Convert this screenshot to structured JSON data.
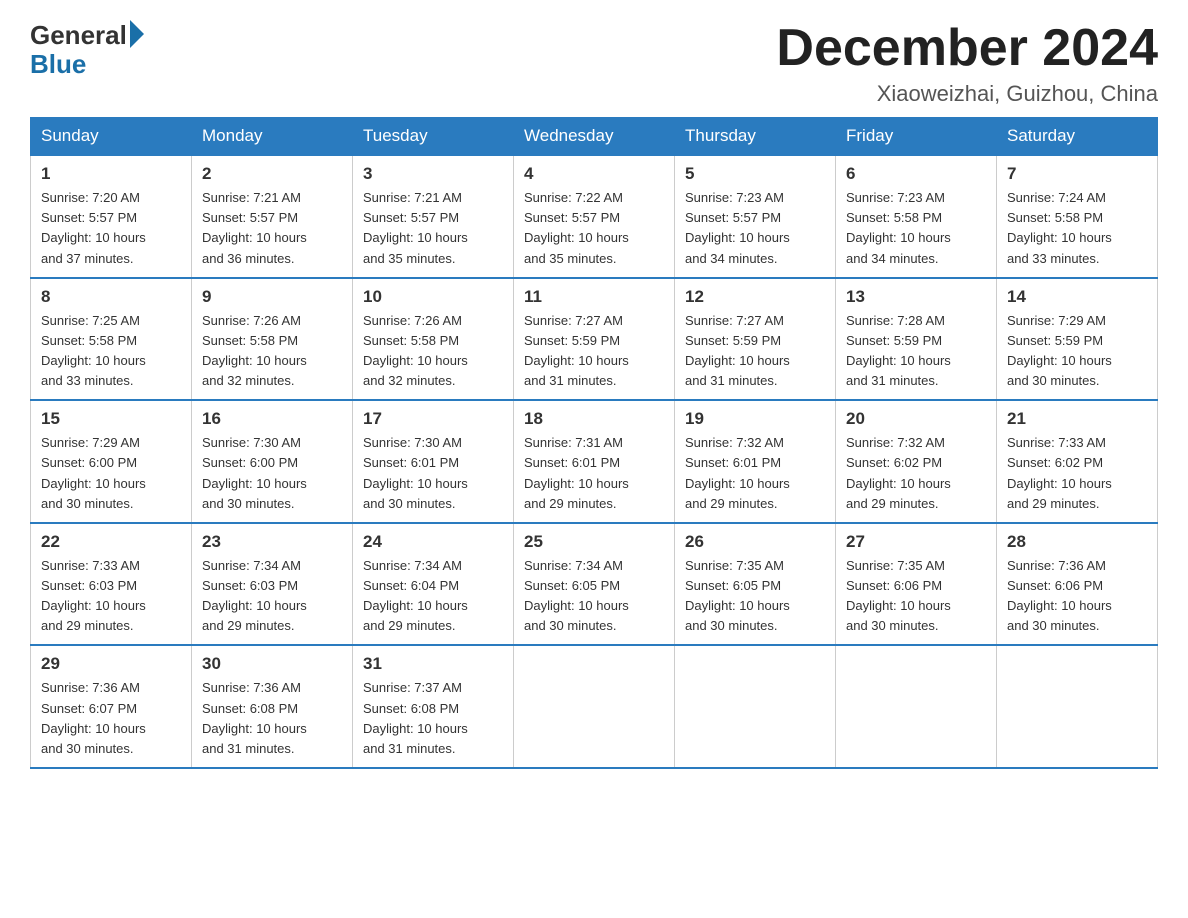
{
  "logo": {
    "general": "General",
    "blue": "Blue"
  },
  "title": "December 2024",
  "location": "Xiaoweizhai, Guizhou, China",
  "days_of_week": [
    "Sunday",
    "Monday",
    "Tuesday",
    "Wednesday",
    "Thursday",
    "Friday",
    "Saturday"
  ],
  "weeks": [
    [
      {
        "day": "1",
        "sunrise": "7:20 AM",
        "sunset": "5:57 PM",
        "daylight": "10 hours and 37 minutes."
      },
      {
        "day": "2",
        "sunrise": "7:21 AM",
        "sunset": "5:57 PM",
        "daylight": "10 hours and 36 minutes."
      },
      {
        "day": "3",
        "sunrise": "7:21 AM",
        "sunset": "5:57 PM",
        "daylight": "10 hours and 35 minutes."
      },
      {
        "day": "4",
        "sunrise": "7:22 AM",
        "sunset": "5:57 PM",
        "daylight": "10 hours and 35 minutes."
      },
      {
        "day": "5",
        "sunrise": "7:23 AM",
        "sunset": "5:57 PM",
        "daylight": "10 hours and 34 minutes."
      },
      {
        "day": "6",
        "sunrise": "7:23 AM",
        "sunset": "5:58 PM",
        "daylight": "10 hours and 34 minutes."
      },
      {
        "day": "7",
        "sunrise": "7:24 AM",
        "sunset": "5:58 PM",
        "daylight": "10 hours and 33 minutes."
      }
    ],
    [
      {
        "day": "8",
        "sunrise": "7:25 AM",
        "sunset": "5:58 PM",
        "daylight": "10 hours and 33 minutes."
      },
      {
        "day": "9",
        "sunrise": "7:26 AM",
        "sunset": "5:58 PM",
        "daylight": "10 hours and 32 minutes."
      },
      {
        "day": "10",
        "sunrise": "7:26 AM",
        "sunset": "5:58 PM",
        "daylight": "10 hours and 32 minutes."
      },
      {
        "day": "11",
        "sunrise": "7:27 AM",
        "sunset": "5:59 PM",
        "daylight": "10 hours and 31 minutes."
      },
      {
        "day": "12",
        "sunrise": "7:27 AM",
        "sunset": "5:59 PM",
        "daylight": "10 hours and 31 minutes."
      },
      {
        "day": "13",
        "sunrise": "7:28 AM",
        "sunset": "5:59 PM",
        "daylight": "10 hours and 31 minutes."
      },
      {
        "day": "14",
        "sunrise": "7:29 AM",
        "sunset": "5:59 PM",
        "daylight": "10 hours and 30 minutes."
      }
    ],
    [
      {
        "day": "15",
        "sunrise": "7:29 AM",
        "sunset": "6:00 PM",
        "daylight": "10 hours and 30 minutes."
      },
      {
        "day": "16",
        "sunrise": "7:30 AM",
        "sunset": "6:00 PM",
        "daylight": "10 hours and 30 minutes."
      },
      {
        "day": "17",
        "sunrise": "7:30 AM",
        "sunset": "6:01 PM",
        "daylight": "10 hours and 30 minutes."
      },
      {
        "day": "18",
        "sunrise": "7:31 AM",
        "sunset": "6:01 PM",
        "daylight": "10 hours and 29 minutes."
      },
      {
        "day": "19",
        "sunrise": "7:32 AM",
        "sunset": "6:01 PM",
        "daylight": "10 hours and 29 minutes."
      },
      {
        "day": "20",
        "sunrise": "7:32 AM",
        "sunset": "6:02 PM",
        "daylight": "10 hours and 29 minutes."
      },
      {
        "day": "21",
        "sunrise": "7:33 AM",
        "sunset": "6:02 PM",
        "daylight": "10 hours and 29 minutes."
      }
    ],
    [
      {
        "day": "22",
        "sunrise": "7:33 AM",
        "sunset": "6:03 PM",
        "daylight": "10 hours and 29 minutes."
      },
      {
        "day": "23",
        "sunrise": "7:34 AM",
        "sunset": "6:03 PM",
        "daylight": "10 hours and 29 minutes."
      },
      {
        "day": "24",
        "sunrise": "7:34 AM",
        "sunset": "6:04 PM",
        "daylight": "10 hours and 29 minutes."
      },
      {
        "day": "25",
        "sunrise": "7:34 AM",
        "sunset": "6:05 PM",
        "daylight": "10 hours and 30 minutes."
      },
      {
        "day": "26",
        "sunrise": "7:35 AM",
        "sunset": "6:05 PM",
        "daylight": "10 hours and 30 minutes."
      },
      {
        "day": "27",
        "sunrise": "7:35 AM",
        "sunset": "6:06 PM",
        "daylight": "10 hours and 30 minutes."
      },
      {
        "day": "28",
        "sunrise": "7:36 AM",
        "sunset": "6:06 PM",
        "daylight": "10 hours and 30 minutes."
      }
    ],
    [
      {
        "day": "29",
        "sunrise": "7:36 AM",
        "sunset": "6:07 PM",
        "daylight": "10 hours and 30 minutes."
      },
      {
        "day": "30",
        "sunrise": "7:36 AM",
        "sunset": "6:08 PM",
        "daylight": "10 hours and 31 minutes."
      },
      {
        "day": "31",
        "sunrise": "7:37 AM",
        "sunset": "6:08 PM",
        "daylight": "10 hours and 31 minutes."
      },
      null,
      null,
      null,
      null
    ]
  ],
  "labels": {
    "sunrise": "Sunrise:",
    "sunset": "Sunset:",
    "daylight": "Daylight:"
  }
}
